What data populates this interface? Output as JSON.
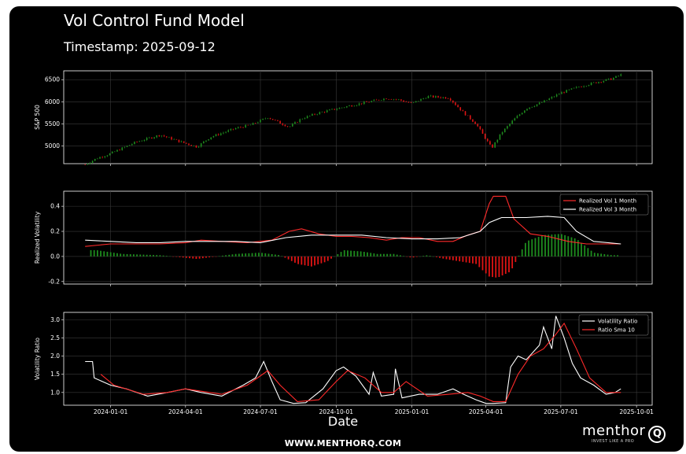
{
  "title": "Vol Control Fund Model",
  "subtitle": "Timestamp: 2025-09-12",
  "footer": "WWW.MENTHORQ.COM",
  "brand": {
    "name": "menthor",
    "mark": "Q",
    "tagline": "INVEST LIKE A PRO"
  },
  "colors": {
    "background": "#000000",
    "up": "#1e8c1e",
    "down": "#e01414",
    "line_primary": "#ff2a2a",
    "line_secondary": "#ffffff",
    "grid": "#3a3a3a"
  },
  "chart_data": [
    {
      "type": "candlestick",
      "ylabel": "S&P 500",
      "ylim": [
        4600,
        6700
      ],
      "yticks": [
        5000,
        5500,
        6000,
        6500
      ],
      "series": [
        {
          "x": "2023-12-01",
          "values": [
            4580,
            4720,
            4830,
            5090,
            5250,
            5100,
            4980,
            5200,
            5400,
            5480,
            5650,
            5520,
            5430,
            5620,
            5750,
            5840,
            5920,
            6000,
            6080,
            6050,
            5960,
            6120,
            6090,
            5750,
            5500,
            4950,
            5300,
            5600,
            5850,
            6000,
            6200,
            6350,
            6450,
            6520,
            6610
          ]
        }
      ],
      "x_dates": [
        "2023-12-01",
        "2023-12-15",
        "2024-01-01",
        "2024-02-01",
        "2024-03-01",
        "2024-03-25",
        "2024-04-15",
        "2024-05-01",
        "2024-06-01",
        "2024-06-20",
        "2024-07-10",
        "2024-07-25",
        "2024-08-05",
        "2024-08-20",
        "2024-09-10",
        "2024-10-01",
        "2024-10-20",
        "2024-11-10",
        "2024-12-01",
        "2024-12-15",
        "2025-01-01",
        "2025-01-20",
        "2025-02-15",
        "2025-03-05",
        "2025-03-20",
        "2025-04-08",
        "2025-04-20",
        "2025-05-05",
        "2025-05-20",
        "2025-06-10",
        "2025-07-01",
        "2025-07-25",
        "2025-08-15",
        "2025-09-01",
        "2025-09-12"
      ]
    },
    {
      "type": "line",
      "ylabel": "Realized Volatility",
      "ylim": [
        -0.22,
        0.52
      ],
      "yticks": [
        -0.2,
        0.0,
        0.2,
        0.4
      ],
      "legend_position": "top-right",
      "series": [
        {
          "name": "Realized Vol 1 Month",
          "x": [
            "2023-12-01",
            "2024-01-01",
            "2024-02-01",
            "2024-03-01",
            "2024-04-01",
            "2024-04-20",
            "2024-05-15",
            "2024-06-15",
            "2024-07-15",
            "2024-08-05",
            "2024-08-20",
            "2024-09-10",
            "2024-10-01",
            "2024-10-20",
            "2024-11-10",
            "2024-12-01",
            "2024-12-20",
            "2025-01-10",
            "2025-02-01",
            "2025-02-20",
            "2025-03-10",
            "2025-03-25",
            "2025-04-05",
            "2025-04-10",
            "2025-04-25",
            "2025-05-05",
            "2025-05-25",
            "2025-06-15",
            "2025-07-10",
            "2025-08-01",
            "2025-08-20",
            "2025-09-12"
          ],
          "values": [
            0.08,
            0.1,
            0.1,
            0.1,
            0.11,
            0.13,
            0.12,
            0.11,
            0.13,
            0.2,
            0.22,
            0.18,
            0.16,
            0.16,
            0.15,
            0.13,
            0.15,
            0.15,
            0.12,
            0.12,
            0.17,
            0.2,
            0.42,
            0.48,
            0.48,
            0.3,
            0.18,
            0.16,
            0.12,
            0.1,
            0.1,
            0.1
          ]
        },
        {
          "name": "Realized Vol 3 Month",
          "x": [
            "2023-12-01",
            "2024-01-01",
            "2024-02-01",
            "2024-03-01",
            "2024-04-01",
            "2024-05-01",
            "2024-06-01",
            "2024-07-01",
            "2024-08-01",
            "2024-09-01",
            "2024-10-01",
            "2024-11-01",
            "2024-12-01",
            "2025-01-01",
            "2025-02-01",
            "2025-03-01",
            "2025-03-25",
            "2025-04-05",
            "2025-04-20",
            "2025-05-20",
            "2025-06-15",
            "2025-07-05",
            "2025-07-20",
            "2025-08-10",
            "2025-09-12"
          ],
          "values": [
            0.13,
            0.12,
            0.11,
            0.11,
            0.12,
            0.12,
            0.12,
            0.11,
            0.15,
            0.17,
            0.17,
            0.17,
            0.15,
            0.14,
            0.14,
            0.15,
            0.2,
            0.27,
            0.31,
            0.31,
            0.32,
            0.31,
            0.2,
            0.12,
            0.1
          ]
        }
      ],
      "bars": {
        "x": [
          "2023-12-15",
          "2024-01-15",
          "2024-03-01",
          "2024-04-15",
          "2024-06-01",
          "2024-07-01",
          "2024-07-25",
          "2024-08-15",
          "2024-09-01",
          "2024-09-20",
          "2024-10-10",
          "2024-11-01",
          "2024-11-20",
          "2024-12-10",
          "2025-01-01",
          "2025-01-20",
          "2025-02-10",
          "2025-03-01",
          "2025-03-20",
          "2025-04-05",
          "2025-04-15",
          "2025-05-01",
          "2025-05-20",
          "2025-06-10",
          "2025-07-01",
          "2025-07-20",
          "2025-08-10",
          "2025-09-01"
        ],
        "values": [
          0.05,
          0.02,
          0.01,
          -0.02,
          0.02,
          0.03,
          0.01,
          -0.06,
          -0.08,
          -0.04,
          0.05,
          0.04,
          0.02,
          0.02,
          -0.01,
          0.01,
          -0.02,
          -0.04,
          -0.06,
          -0.16,
          -0.17,
          -0.12,
          0.12,
          0.17,
          0.18,
          0.14,
          0.03,
          0.01
        ]
      }
    },
    {
      "type": "line",
      "ylabel": "Volatility Ratio",
      "ylim": [
        0.65,
        3.2
      ],
      "yticks": [
        1.0,
        1.5,
        2.0,
        2.5,
        3.0
      ],
      "legend_position": "top-right",
      "xlabel": "Date",
      "xticks": [
        "2024-01-01",
        "2024-04-01",
        "2024-07-01",
        "2024-10-01",
        "2025-01-01",
        "2025-04-01",
        "2025-07-01",
        "2025-10-01"
      ],
      "series": [
        {
          "name": "Volatility Ratio",
          "x": [
            "2023-12-01",
            "2023-12-10",
            "2023-12-12",
            "2024-01-01",
            "2024-01-20",
            "2024-02-15",
            "2024-03-10",
            "2024-04-01",
            "2024-04-20",
            "2024-05-15",
            "2024-06-10",
            "2024-06-25",
            "2024-07-05",
            "2024-07-15",
            "2024-07-25",
            "2024-08-10",
            "2024-08-25",
            "2024-09-15",
            "2024-10-01",
            "2024-10-10",
            "2024-10-25",
            "2024-11-10",
            "2024-11-15",
            "2024-11-25",
            "2024-12-10",
            "2024-12-12",
            "2024-12-20",
            "2025-01-10",
            "2025-02-01",
            "2025-02-20",
            "2025-03-05",
            "2025-03-20",
            "2025-04-01",
            "2025-04-10",
            "2025-04-25",
            "2025-05-01",
            "2025-05-10",
            "2025-05-20",
            "2025-06-05",
            "2025-06-10",
            "2025-06-20",
            "2025-06-25",
            "2025-07-05",
            "2025-07-15",
            "2025-07-25",
            "2025-08-10",
            "2025-08-25",
            "2025-09-05",
            "2025-09-12"
          ],
          "values": [
            1.85,
            1.85,
            1.4,
            1.2,
            1.1,
            0.9,
            1.0,
            1.1,
            1.0,
            0.9,
            1.2,
            1.4,
            1.85,
            1.3,
            0.8,
            0.7,
            0.72,
            1.1,
            1.6,
            1.7,
            1.45,
            0.95,
            1.55,
            0.9,
            0.95,
            1.65,
            0.85,
            0.95,
            0.95,
            1.1,
            0.95,
            0.8,
            0.7,
            0.7,
            0.72,
            1.7,
            2.0,
            1.9,
            2.3,
            2.8,
            2.2,
            3.1,
            2.5,
            1.8,
            1.4,
            1.2,
            0.95,
            1.0,
            1.1
          ]
        },
        {
          "name": "Ratio Sma 10",
          "x": [
            "2023-12-20",
            "2024-01-05",
            "2024-02-10",
            "2024-03-10",
            "2024-04-01",
            "2024-05-15",
            "2024-06-15",
            "2024-07-10",
            "2024-07-25",
            "2024-08-15",
            "2024-09-10",
            "2024-10-01",
            "2024-10-15",
            "2024-11-05",
            "2024-11-25",
            "2024-12-10",
            "2024-12-25",
            "2025-01-20",
            "2025-02-15",
            "2025-03-10",
            "2025-03-25",
            "2025-04-10",
            "2025-04-25",
            "2025-05-10",
            "2025-05-25",
            "2025-06-10",
            "2025-06-25",
            "2025-07-05",
            "2025-07-20",
            "2025-08-05",
            "2025-08-25",
            "2025-09-12"
          ],
          "values": [
            1.5,
            1.2,
            0.95,
            1.0,
            1.1,
            0.95,
            1.2,
            1.6,
            1.2,
            0.75,
            0.8,
            1.3,
            1.6,
            1.4,
            1.0,
            1.0,
            1.3,
            0.9,
            0.95,
            1.0,
            0.9,
            0.75,
            0.75,
            1.5,
            2.0,
            2.2,
            2.6,
            2.9,
            2.2,
            1.4,
            1.0,
            1.0
          ]
        }
      ]
    }
  ]
}
